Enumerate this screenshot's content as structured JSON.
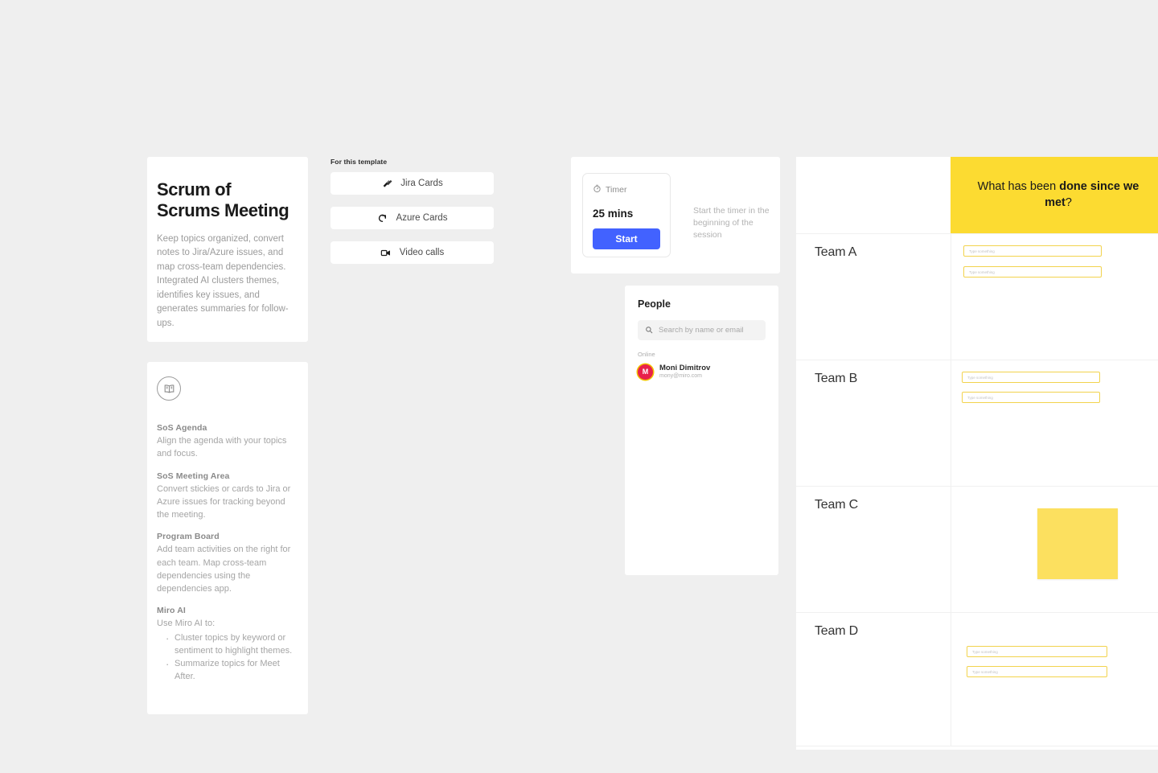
{
  "title_card": {
    "heading": "Scrum of Scrums Meeting",
    "body": "Keep topics organized, convert notes to Jira/Azure issues, and map cross-team dependencies. Integrated AI clusters themes, identifies key issues, and generates summaries for follow-ups."
  },
  "agenda_card": {
    "icon": "book-icon",
    "blocks": [
      {
        "heading": "SoS Agenda",
        "body": "Align the agenda with your topics and focus."
      },
      {
        "heading": "SoS Meeting Area",
        "body": "Convert stickies or cards to Jira or Azure issues for tracking beyond the meeting."
      },
      {
        "heading": "Program Board",
        "body": "Add team activities on the right for each team. Map cross-team dependencies using the dependencies app."
      }
    ],
    "ai": {
      "heading": "Miro AI",
      "body": "Use Miro AI to:",
      "items": [
        "Cluster topics by keyword or sentiment to highlight themes.",
        "Summarize topics for Meet After."
      ]
    }
  },
  "apps": {
    "label": "For this template",
    "buttons": [
      {
        "label": "Jira Cards",
        "icon": "jira-icon"
      },
      {
        "label": "Azure Cards",
        "icon": "azure-icon"
      },
      {
        "label": "Video calls",
        "icon": "video-camera-icon"
      }
    ]
  },
  "timer": {
    "label": "Timer",
    "icon": "stopwatch-icon",
    "value": "25 mins",
    "start_label": "Start",
    "hint": "Start the timer in the beginning of the session"
  },
  "people": {
    "title": "People",
    "search_placeholder": "Search by name or email",
    "search_icon": "search-icon",
    "online_label": "Online",
    "members": [
      {
        "initial": "M",
        "name": "Moni Dimitrov",
        "email": "mony@miro.com"
      }
    ]
  },
  "board": {
    "banner": {
      "prefix": "What has been ",
      "bold": "done since we met",
      "suffix": "?"
    },
    "placeholder": "Type something",
    "rows": [
      {
        "label": "Team A",
        "inputs": 2,
        "sticky": false
      },
      {
        "label": "Team B",
        "inputs": 2,
        "sticky": false
      },
      {
        "label": "Team C",
        "inputs": 0,
        "sticky": true
      },
      {
        "label": "Team D",
        "inputs": 2,
        "sticky": false
      }
    ]
  },
  "colors": {
    "background": "#efefef",
    "accent_blue": "#4262ff",
    "banner_yellow": "#fcdb31",
    "sticky_yellow": "#fce05f",
    "avatar_red": "#e8214b"
  }
}
